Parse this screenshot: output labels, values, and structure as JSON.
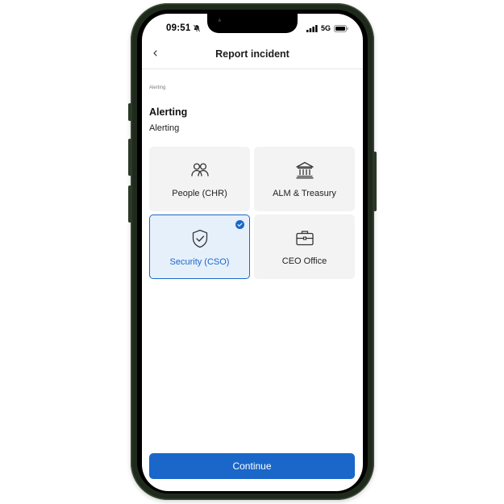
{
  "status_bar": {
    "time": "09:51",
    "network": "5G"
  },
  "header": {
    "title": "Report incident"
  },
  "breadcrumb": "Alerting",
  "section": {
    "title": "Alerting",
    "subtitle": "Alerting"
  },
  "options": [
    {
      "label": "People (CHR)",
      "icon": "people-icon",
      "selected": false
    },
    {
      "label": "ALM & Treasury",
      "icon": "bank-icon",
      "selected": false
    },
    {
      "label": "Security (CSO)",
      "icon": "shield-check-icon",
      "selected": true
    },
    {
      "label": "CEO Office",
      "icon": "briefcase-icon",
      "selected": false
    }
  ],
  "actions": {
    "continue_label": "Continue"
  },
  "colors": {
    "accent": "#1a67c9",
    "card_bg": "#f3f3f3",
    "selected_bg": "#e6f0fb",
    "phone_frame": "#1f2a1c"
  }
}
